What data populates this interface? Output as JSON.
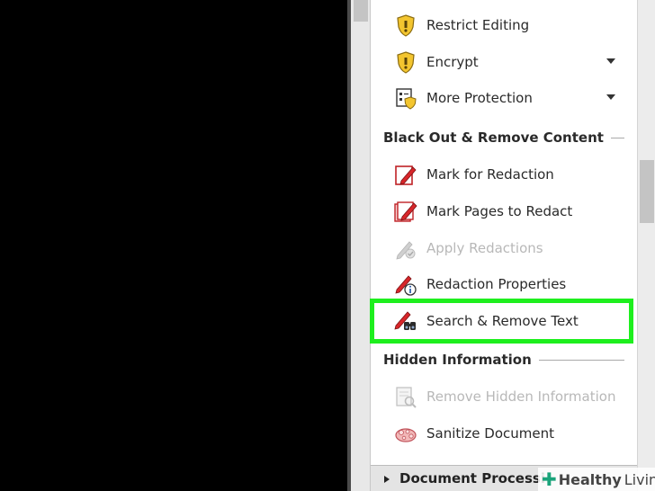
{
  "protection_items": [
    {
      "label": "Restrict Editing",
      "icon": "shield-icon",
      "has_menu": false
    },
    {
      "label": "Encrypt",
      "icon": "shield-icon",
      "has_menu": true
    },
    {
      "label": "More Protection",
      "icon": "protection-icon",
      "has_menu": true
    }
  ],
  "sections": {
    "black_out": "Black Out & Remove Content",
    "hidden": "Hidden Information"
  },
  "redaction_items": [
    {
      "label": "Mark for Redaction",
      "icon": "mark-redaction-icon",
      "enabled": true
    },
    {
      "label": "Mark Pages to Redact",
      "icon": "mark-pages-icon",
      "enabled": true
    },
    {
      "label": "Apply Redactions",
      "icon": "apply-redactions-icon",
      "enabled": false
    },
    {
      "label": "Redaction Properties",
      "icon": "redaction-properties-icon",
      "enabled": true
    },
    {
      "label": "Search & Remove Text",
      "icon": "search-remove-icon",
      "enabled": true,
      "highlighted": true
    }
  ],
  "hidden_items": [
    {
      "label": "Remove Hidden Information",
      "icon": "remove-hidden-icon",
      "enabled": false
    },
    {
      "label": "Sanitize Document",
      "icon": "sanitize-icon",
      "enabled": true
    }
  ],
  "footer": {
    "label": "Document Processi"
  },
  "watermark": {
    "brand": "Healthy",
    "brand2": "Living"
  },
  "colors": {
    "highlight": "#1eef1e",
    "shield": "#f0c22a",
    "pencil": "#d8262a"
  }
}
